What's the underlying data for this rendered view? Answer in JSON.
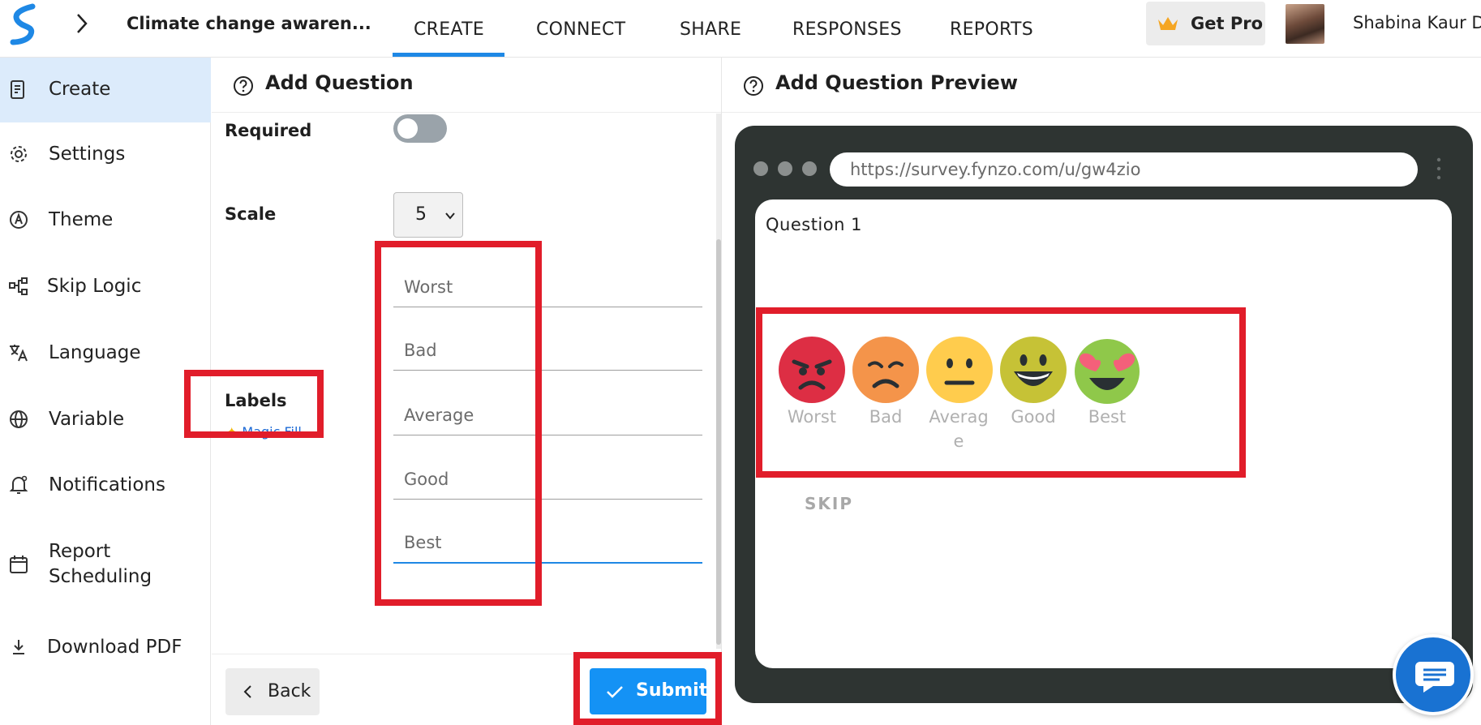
{
  "header": {
    "survey_title": "Climate change awaren...",
    "tabs": [
      {
        "label": "CREATE",
        "active": true
      },
      {
        "label": "CONNECT",
        "active": false
      },
      {
        "label": "SHARE",
        "active": false
      },
      {
        "label": "RESPONSES",
        "active": false
      },
      {
        "label": "REPORTS",
        "active": false
      }
    ],
    "get_pro_label": "Get Pro",
    "user_name": "Shabina Kaur D",
    "accent_color": "#1e88e5"
  },
  "sidebar": {
    "items": [
      {
        "label": "Create",
        "icon": "create-doc-icon",
        "active": true
      },
      {
        "label": "Settings",
        "icon": "gear-icon",
        "active": false
      },
      {
        "label": "Theme",
        "icon": "theme-icon",
        "active": false
      },
      {
        "label": "Skip Logic",
        "icon": "skip-logic-icon",
        "active": false
      },
      {
        "label": "Language",
        "icon": "translate-icon",
        "active": false
      },
      {
        "label": "Variable",
        "icon": "globe-icon",
        "active": false
      },
      {
        "label": "Notifications",
        "icon": "bell-icon",
        "active": false
      },
      {
        "label": "Report Scheduling",
        "icon": "calendar-icon",
        "active": false
      },
      {
        "label": "Download PDF",
        "icon": "download-icon",
        "active": false
      }
    ]
  },
  "editor": {
    "title": "Add Question",
    "required_label": "Required",
    "required_on": false,
    "scale_label": "Scale",
    "scale_value": "5",
    "labels_heading": "Labels",
    "magic_fill_label": "Magic Fill",
    "labels": [
      "Worst",
      "Bad",
      "Average",
      "Good",
      "Best"
    ],
    "back_label": "Back",
    "submit_label": "Submit",
    "submit_color": "#1492f5"
  },
  "preview": {
    "title": "Add Question Preview",
    "url": "https://survey.fynzo.com/u/gw4zio",
    "question_title": "Question 1",
    "options": [
      {
        "label": "Worst",
        "face": "angry-face-icon"
      },
      {
        "label": "Bad",
        "face": "frowning-face-icon"
      },
      {
        "label": "Averag e",
        "face": "neutral-face-icon"
      },
      {
        "label": "Good",
        "face": "smiling-face-icon"
      },
      {
        "label": "Best",
        "face": "heart-eyes-face-icon"
      }
    ],
    "skip_label": "SKIP"
  },
  "highlight_color": "#e11d2a"
}
